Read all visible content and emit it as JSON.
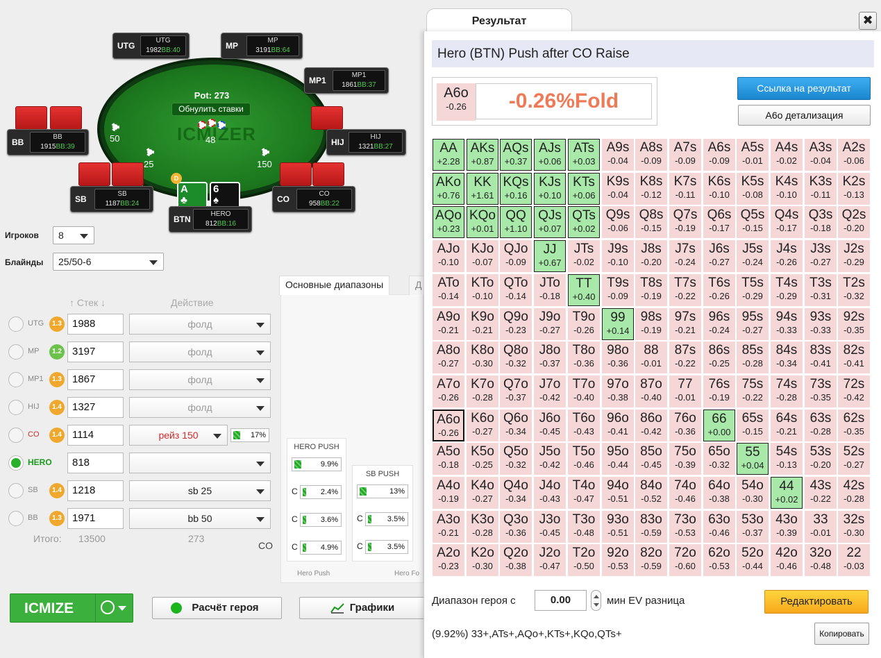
{
  "table": {
    "pot_label": "Pot: 273",
    "reset_label": "Обнулить ставки",
    "watermark": "ICMIZER",
    "bets": {
      "bb": "50",
      "sb": "25",
      "co": "150",
      "hero": "48"
    },
    "dealer": "D",
    "seats": [
      {
        "key": "utg",
        "pos": "UTG",
        "name": "UTG",
        "stack": "1982",
        "bb": "BB:40"
      },
      {
        "key": "mp",
        "pos": "MP",
        "name": "MP",
        "stack": "3191",
        "bb": "BB:64"
      },
      {
        "key": "mp1",
        "pos": "MP1",
        "name": "MP1",
        "stack": "1861",
        "bb": "BB:37"
      },
      {
        "key": "bb",
        "pos": "BB",
        "name": "BB",
        "stack": "1915",
        "bb": "BB:39"
      },
      {
        "key": "hij",
        "pos": "HIJ",
        "name": "HIJ",
        "stack": "1321",
        "bb": "BB:27"
      },
      {
        "key": "sb",
        "pos": "SB",
        "name": "SB",
        "stack": "1187",
        "bb": "BB:24"
      },
      {
        "key": "co",
        "pos": "CO",
        "name": "CO",
        "stack": "958",
        "bb": "BB:22"
      },
      {
        "key": "hero",
        "pos": "BTN",
        "name": "HERO",
        "stack": "812",
        "bb": "BB:16"
      }
    ],
    "hero_cards": [
      {
        "rank": "A",
        "suit": "♣"
      },
      {
        "rank": "6",
        "suit": "♠"
      }
    ]
  },
  "settings": {
    "players_label": "Игроков",
    "players_value": "8",
    "blinds_label": "Блайнды",
    "blinds_value": "25/50-6",
    "col_stack": "↑ Стек ↓",
    "col_action": "Действие"
  },
  "rows": [
    {
      "pos": "UTG",
      "badge": "1.3",
      "stack": "1988",
      "action": "фолд"
    },
    {
      "pos": "MP",
      "badge": "1.2",
      "stack": "3197",
      "action": "фолд"
    },
    {
      "pos": "MP1",
      "badge": "1.3",
      "stack": "1867",
      "action": "фолд"
    },
    {
      "pos": "HIJ",
      "badge": "1.4",
      "stack": "1327",
      "action": "фолд"
    },
    {
      "pos": "CO",
      "badge": "1.4",
      "stack": "1114",
      "action": "рейз 150",
      "pct": "17%"
    },
    {
      "pos": "HERO",
      "badge": "",
      "stack": "818",
      "action": ""
    },
    {
      "pos": "SB",
      "badge": "1.4",
      "stack": "1218",
      "action": "sb 25"
    },
    {
      "pos": "BB",
      "badge": "1.3",
      "stack": "1971",
      "action": "bb 50"
    }
  ],
  "totals": {
    "label": "Итого:",
    "stack": "13500",
    "action": "273",
    "pos": "CO"
  },
  "tabs": {
    "main": "Основные диапазоны",
    "second": "Д"
  },
  "hero_push": {
    "title": "HERO PUSH",
    "main": "9.9%",
    "c": [
      "2.4%",
      "3.6%",
      "4.9%"
    ],
    "c_label": "С",
    "footer": "Hero Push"
  },
  "sb_push": {
    "title": "SB PUSH",
    "main": "13%",
    "c": [
      "3.5%",
      "3.5%"
    ],
    "c_label": "С",
    "footer": "Hero Fo"
  },
  "buttons": {
    "icmize": "ICMIZE",
    "hero_calc": "Расчёт героя",
    "charts": "Графики"
  },
  "dialog": {
    "tab": "Результат",
    "close": "✖",
    "title": "Hero (BTN) Push after CO Raise",
    "hand": "A6o",
    "hand_ev": "-0.26",
    "result": "-0.26%Fold",
    "link_btn": "Ссылка на результат",
    "detail_btn": "A6o детализация",
    "range_label": "Диапазон героя с",
    "range_value": "0.00",
    "range_suffix": "мин EV разница",
    "edit_btn": "Редактировать",
    "summary": "(9.92%) 33+,ATs+,AQo+,KTs+,KQo,QTs+",
    "copy_btn": "Копировать"
  },
  "colors": {
    "green": "#a8e8a8",
    "red": "#f5d7d8",
    "accent_red": "#ef7a57",
    "blue": "#1a86cf"
  },
  "grid": [
    [
      [
        "AA",
        "+2.28"
      ],
      [
        "AKs",
        "+0.87"
      ],
      [
        "AQs",
        "+0.37"
      ],
      [
        "AJs",
        "+0.06"
      ],
      [
        "ATs",
        "+0.03"
      ],
      [
        "A9s",
        "-0.04"
      ],
      [
        "A8s",
        "-0.09"
      ],
      [
        "A7s",
        "-0.09"
      ],
      [
        "A6s",
        "-0.09"
      ],
      [
        "A5s",
        "-0.01"
      ],
      [
        "A4s",
        "-0.02"
      ],
      [
        "A3s",
        "-0.04"
      ],
      [
        "A2s",
        "-0.06"
      ]
    ],
    [
      [
        "AKo",
        "+0.76"
      ],
      [
        "KK",
        "+1.61"
      ],
      [
        "KQs",
        "+0.16"
      ],
      [
        "KJs",
        "+0.10"
      ],
      [
        "KTs",
        "+0.06"
      ],
      [
        "K9s",
        "-0.04"
      ],
      [
        "K8s",
        "-0.12"
      ],
      [
        "K7s",
        "-0.11"
      ],
      [
        "K6s",
        "-0.10"
      ],
      [
        "K5s",
        "-0.08"
      ],
      [
        "K4s",
        "-0.10"
      ],
      [
        "K3s",
        "-0.11"
      ],
      [
        "K2s",
        "-0.13"
      ]
    ],
    [
      [
        "AQo",
        "+0.23"
      ],
      [
        "KQo",
        "+0.01"
      ],
      [
        "QQ",
        "+1.10"
      ],
      [
        "QJs",
        "+0.07"
      ],
      [
        "QTs",
        "+0.02"
      ],
      [
        "Q9s",
        "-0.06"
      ],
      [
        "Q8s",
        "-0.15"
      ],
      [
        "Q7s",
        "-0.19"
      ],
      [
        "Q6s",
        "-0.17"
      ],
      [
        "Q5s",
        "-0.15"
      ],
      [
        "Q4s",
        "-0.17"
      ],
      [
        "Q3s",
        "-0.18"
      ],
      [
        "Q2s",
        "-0.20"
      ]
    ],
    [
      [
        "AJo",
        "-0.10"
      ],
      [
        "KJo",
        "-0.07"
      ],
      [
        "QJo",
        "-0.09"
      ],
      [
        "JJ",
        "+0.67"
      ],
      [
        "JTs",
        "-0.02"
      ],
      [
        "J9s",
        "-0.10"
      ],
      [
        "J8s",
        "-0.20"
      ],
      [
        "J7s",
        "-0.24"
      ],
      [
        "J6s",
        "-0.27"
      ],
      [
        "J5s",
        "-0.24"
      ],
      [
        "J4s",
        "-0.26"
      ],
      [
        "J3s",
        "-0.27"
      ],
      [
        "J2s",
        "-0.29"
      ]
    ],
    [
      [
        "ATo",
        "-0.14"
      ],
      [
        "KTo",
        "-0.10"
      ],
      [
        "QTo",
        "-0.14"
      ],
      [
        "JTo",
        "-0.18"
      ],
      [
        "TT",
        "+0.40"
      ],
      [
        "T9s",
        "-0.09"
      ],
      [
        "T8s",
        "-0.19"
      ],
      [
        "T7s",
        "-0.22"
      ],
      [
        "T6s",
        "-0.26"
      ],
      [
        "T5s",
        "-0.29"
      ],
      [
        "T4s",
        "-0.29"
      ],
      [
        "T3s",
        "-0.31"
      ],
      [
        "T2s",
        "-0.32"
      ]
    ],
    [
      [
        "A9o",
        "-0.21"
      ],
      [
        "K9o",
        "-0.21"
      ],
      [
        "Q9o",
        "-0.23"
      ],
      [
        "J9o",
        "-0.27"
      ],
      [
        "T9o",
        "-0.26"
      ],
      [
        "99",
        "+0.14"
      ],
      [
        "98s",
        "-0.19"
      ],
      [
        "97s",
        "-0.21"
      ],
      [
        "96s",
        "-0.24"
      ],
      [
        "95s",
        "-0.27"
      ],
      [
        "94s",
        "-0.33"
      ],
      [
        "93s",
        "-0.33"
      ],
      [
        "92s",
        "-0.35"
      ]
    ],
    [
      [
        "A8o",
        "-0.27"
      ],
      [
        "K8o",
        "-0.30"
      ],
      [
        "Q8o",
        "-0.32"
      ],
      [
        "J8o",
        "-0.37"
      ],
      [
        "T8o",
        "-0.36"
      ],
      [
        "98o",
        "-0.36"
      ],
      [
        "88",
        "-0.01"
      ],
      [
        "87s",
        "-0.22"
      ],
      [
        "86s",
        "-0.25"
      ],
      [
        "85s",
        "-0.28"
      ],
      [
        "84s",
        "-0.34"
      ],
      [
        "83s",
        "-0.41"
      ],
      [
        "82s",
        "-0.41"
      ]
    ],
    [
      [
        "A7o",
        "-0.26"
      ],
      [
        "K7o",
        "-0.28"
      ],
      [
        "Q7o",
        "-0.37"
      ],
      [
        "J7o",
        "-0.42"
      ],
      [
        "T7o",
        "-0.40"
      ],
      [
        "97o",
        "-0.38"
      ],
      [
        "87o",
        "-0.40"
      ],
      [
        "77",
        "-0.01"
      ],
      [
        "76s",
        "-0.19"
      ],
      [
        "75s",
        "-0.22"
      ],
      [
        "74s",
        "-0.28"
      ],
      [
        "73s",
        "-0.35"
      ],
      [
        "72s",
        "-0.42"
      ]
    ],
    [
      [
        "A6o",
        "-0.26"
      ],
      [
        "K6o",
        "-0.27"
      ],
      [
        "Q6o",
        "-0.34"
      ],
      [
        "J6o",
        "-0.45"
      ],
      [
        "T6o",
        "-0.43"
      ],
      [
        "96o",
        "-0.41"
      ],
      [
        "86o",
        "-0.42"
      ],
      [
        "76o",
        "-0.36"
      ],
      [
        "66",
        "+0.00"
      ],
      [
        "65s",
        "-0.15"
      ],
      [
        "64s",
        "-0.21"
      ],
      [
        "63s",
        "-0.28"
      ],
      [
        "62s",
        "-0.35"
      ]
    ],
    [
      [
        "A5o",
        "-0.18"
      ],
      [
        "K5o",
        "-0.25"
      ],
      [
        "Q5o",
        "-0.32"
      ],
      [
        "J5o",
        "-0.42"
      ],
      [
        "T5o",
        "-0.46"
      ],
      [
        "95o",
        "-0.44"
      ],
      [
        "85o",
        "-0.45"
      ],
      [
        "75o",
        "-0.39"
      ],
      [
        "65o",
        "-0.32"
      ],
      [
        "55",
        "+0.04"
      ],
      [
        "54s",
        "-0.13"
      ],
      [
        "53s",
        "-0.20"
      ],
      [
        "52s",
        "-0.27"
      ]
    ],
    [
      [
        "A4o",
        "-0.19"
      ],
      [
        "K4o",
        "-0.27"
      ],
      [
        "Q4o",
        "-0.34"
      ],
      [
        "J4o",
        "-0.43"
      ],
      [
        "T4o",
        "-0.47"
      ],
      [
        "94o",
        "-0.51"
      ],
      [
        "84o",
        "-0.52"
      ],
      [
        "74o",
        "-0.46"
      ],
      [
        "64o",
        "-0.38"
      ],
      [
        "54o",
        "-0.30"
      ],
      [
        "44",
        "+0.02"
      ],
      [
        "43s",
        "-0.22"
      ],
      [
        "42s",
        "-0.28"
      ]
    ],
    [
      [
        "A3o",
        "-0.21"
      ],
      [
        "K3o",
        "-0.28"
      ],
      [
        "Q3o",
        "-0.36"
      ],
      [
        "J3o",
        "-0.45"
      ],
      [
        "T3o",
        "-0.48"
      ],
      [
        "93o",
        "-0.51"
      ],
      [
        "83o",
        "-0.59"
      ],
      [
        "73o",
        "-0.53"
      ],
      [
        "63o",
        "-0.46"
      ],
      [
        "53o",
        "-0.37"
      ],
      [
        "43o",
        "-0.39"
      ],
      [
        "33",
        "-0.01"
      ],
      [
        "32s",
        "-0.30"
      ]
    ],
    [
      [
        "A2o",
        "-0.23"
      ],
      [
        "K2o",
        "-0.30"
      ],
      [
        "Q2o",
        "-0.38"
      ],
      [
        "J2o",
        "-0.47"
      ],
      [
        "T2o",
        "-0.50"
      ],
      [
        "92o",
        "-0.53"
      ],
      [
        "82o",
        "-0.59"
      ],
      [
        "72o",
        "-0.60"
      ],
      [
        "62o",
        "-0.53"
      ],
      [
        "52o",
        "-0.44"
      ],
      [
        "42o",
        "-0.46"
      ],
      [
        "32o",
        "-0.48"
      ],
      [
        "22",
        "-0.03"
      ]
    ]
  ],
  "in_range": [
    "AA",
    "AKs",
    "AQs",
    "AJs",
    "ATs",
    "AKo",
    "KK",
    "KQs",
    "KJs",
    "KTs",
    "AQo",
    "KQo",
    "QQ",
    "QJs",
    "QTs",
    "JJ",
    "TT",
    "99",
    "66",
    "55",
    "44"
  ],
  "selected_hand": "A6o"
}
